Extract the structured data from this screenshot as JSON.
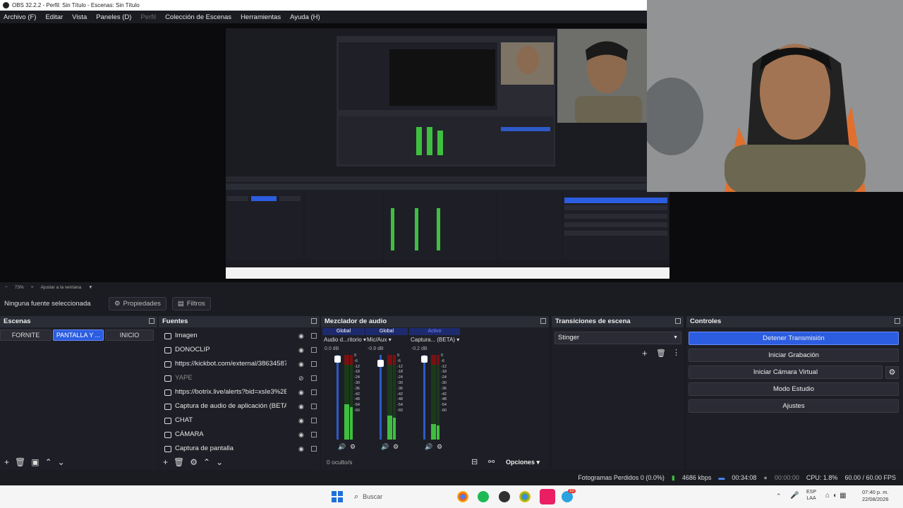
{
  "window": {
    "title": "OBS 32.2.2 - Perfil: Sin Título - Escenas: Sin Título"
  },
  "menu": [
    "Archivo (F)",
    "Editar",
    "Vista",
    "Paneles (D)",
    "Perfil",
    "Colección de Escenas",
    "Herramientas",
    "Ayuda (H)"
  ],
  "zoom": {
    "level": "73%",
    "fit": "Ajustar a la ventana"
  },
  "propbar": {
    "selection": "Ninguna fuente seleccionada",
    "properties": "Propiedades",
    "filters": "Filtros"
  },
  "scenes": {
    "title": "Escenas",
    "items": [
      "FORNITE",
      "PANTALLA Y ...",
      "INICIO"
    ],
    "active": "PANTALLA Y ..."
  },
  "sources": {
    "title": "Fuentes",
    "items": [
      {
        "name": "Imagen",
        "icon": "image-icon",
        "visible": true
      },
      {
        "name": "DONOCLIP",
        "icon": "globe-icon",
        "visible": true
      },
      {
        "name": "https://kickbot.com/external/38634587",
        "icon": "globe-icon",
        "visible": true
      },
      {
        "name": "YAPE",
        "icon": "globe-icon",
        "visible": false
      },
      {
        "name": "https://botrix.live/alerts?bid=xsIe3%2B9",
        "icon": "globe-icon",
        "visible": true
      },
      {
        "name": "Captura de audio de aplicación (BETA)",
        "icon": "audio-capture-icon",
        "visible": true
      },
      {
        "name": "CHAT",
        "icon": "globe-icon",
        "visible": true
      },
      {
        "name": "CÁMARA",
        "icon": "camera-icon",
        "visible": true
      },
      {
        "name": "Captura de pantalla",
        "icon": "monitor-icon",
        "visible": true
      }
    ]
  },
  "mixer": {
    "title": "Mezclador de audio",
    "channels": [
      {
        "tag": "Global",
        "name": "Audio d...ritorio",
        "db": "0.0 dB"
      },
      {
        "tag": "Global",
        "name": "Mic/Aux",
        "db": "-0.9 dB"
      },
      {
        "tag": "Activo",
        "name": "Captura... (BETA)",
        "db": "-0.2 dB"
      }
    ],
    "scale": [
      "0",
      "-6",
      "-12",
      "-18",
      "-24",
      "-30",
      "-36",
      "-42",
      "-48",
      "-54",
      "-60"
    ],
    "hidden": "0 oculto/s",
    "options": "Opciones"
  },
  "transitions": {
    "title": "Transiciones de escena",
    "selected": "Stinger"
  },
  "controls": {
    "title": "Controles",
    "buttons": [
      "Detener Transmisión",
      "Iniciar Grabación",
      "Iniciar Cámara Virtual",
      "Modo Estudio",
      "Ajustes"
    ]
  },
  "status": {
    "dropped": "Fotogramas Perdidos 0 (0.0%)",
    "kbps": "4686 kbps",
    "stream_time": "00:34:08",
    "rec_time": "00:00:00",
    "cpu": "CPU: 1.8%",
    "fps": "60.00 / 60.00 FPS"
  },
  "taskbar": {
    "search": "Buscar",
    "lang_top": "ESP",
    "lang_bottom": "LAA",
    "time": "07:40 p. m.",
    "date": "22/08/2026",
    "badge": "10"
  }
}
